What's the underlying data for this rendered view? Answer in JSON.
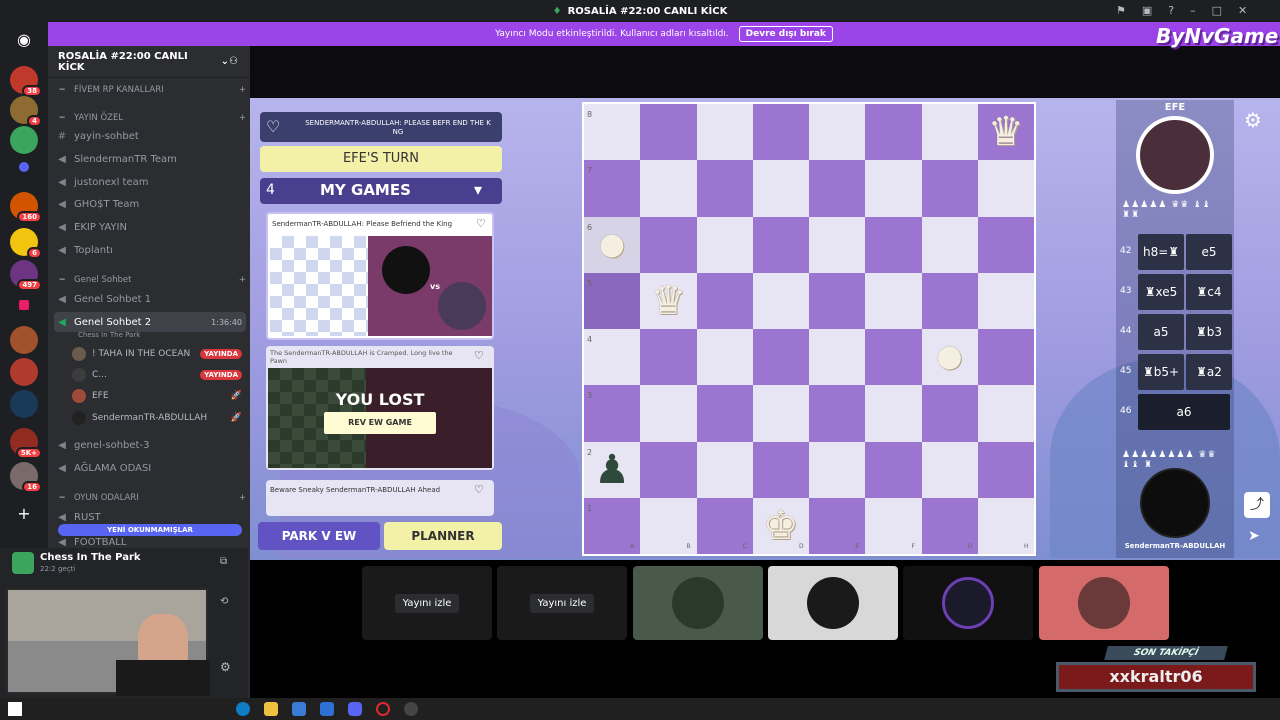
{
  "window": {
    "title": "ROSALİA #22:00 CANLI KİCK"
  },
  "notice": {
    "text": "Yayıncı Modu etkinleştirildi. Kullanıcı adları kısaltıldı.",
    "button": "Devre dışı bırak"
  },
  "guild_badges": [
    "38",
    "4",
    "160",
    "6",
    "497",
    "5K+",
    "16"
  ],
  "server": {
    "name": "ROSALİA #22:00 CANLI KİCK"
  },
  "channels": {
    "cat1": "FİVEM RP KANALLARI",
    "cat2": "YAYIN ÖZEL",
    "items": [
      "yayin-sohbet",
      "SlendermanTR Team",
      "justonexl team",
      "GHO$T Team",
      "EKIP YAYIN",
      "Toplantı"
    ],
    "cat3": "Genel Sohbet",
    "gs1": "Genel Sohbet 1",
    "gs2": "Genel Sohbet 2",
    "gs2_time": "1:36:40",
    "gs2_activity": "Chess In The Park",
    "users": [
      {
        "name": "! TAHA IN THE OCEAN",
        "live": "YAYINDA"
      },
      {
        "name": "C...",
        "live": "YAYINDA"
      },
      {
        "name": "EFE",
        "live": ""
      },
      {
        "name": "SendermanTR-ABDULLAH",
        "live": ""
      }
    ],
    "gs3": "genel-sohbet-3",
    "aglama": "AĞLAMA ODASI",
    "cat4": "OYUN ODALARI",
    "rust": "RUST",
    "football": "FOOTBALL",
    "unread": "YENİ OKUNMAMIŞLAR"
  },
  "activity": {
    "title": "Chess In The Park",
    "sub": "22:2 geçti"
  },
  "game": {
    "header_text": "SENDERMANTR-ABDULLAH: PLEASE BEFR END THE K NG",
    "turn": "EFE'S TURN",
    "games_count": "4",
    "my_games": "MY GAMES",
    "card1_title": "SendermanTR-ABDULLAH: Please Befriend the King",
    "card1_vs": "vs",
    "card2_title": "The SendermanTR-ABDULLAH is Cramped. Long live the Pawn",
    "card2_result": "YOU LOST",
    "card2_button": "REV EW GAME",
    "card3_title": "Beware Sneaky SendermanTR-ABDULLAH Ahead",
    "park_view": "PARK V EW",
    "planner": "PLANNER",
    "player_top": "EFE",
    "player_bottom": "SendermanTR-ABDULLAH",
    "ranks": [
      "8",
      "7",
      "6",
      "5",
      "4",
      "3",
      "2",
      "1"
    ],
    "files": [
      "A",
      "B",
      "C",
      "D",
      "E",
      "F",
      "G",
      "H"
    ],
    "moves": [
      {
        "n": "42",
        "w": "h8=♜",
        "b": "e5"
      },
      {
        "n": "43",
        "w": "♜xe5",
        "b": "♜c4"
      },
      {
        "n": "44",
        "w": "a5",
        "b": "♜b3"
      },
      {
        "n": "45",
        "w": "♜b5+",
        "b": "♜a2"
      },
      {
        "n": "46",
        "w": "a6",
        "b": ""
      }
    ]
  },
  "thumbs": [
    {
      "label": "Yayını izle"
    },
    {
      "label": "Yayını izle"
    },
    {
      "label": ""
    },
    {
      "label": ""
    },
    {
      "label": ""
    },
    {
      "label": ""
    }
  ],
  "son_takipci": {
    "title": "SON TAKİPÇİ",
    "name": "xxkraltr06"
  },
  "overlay_logo": "ByNvGame"
}
